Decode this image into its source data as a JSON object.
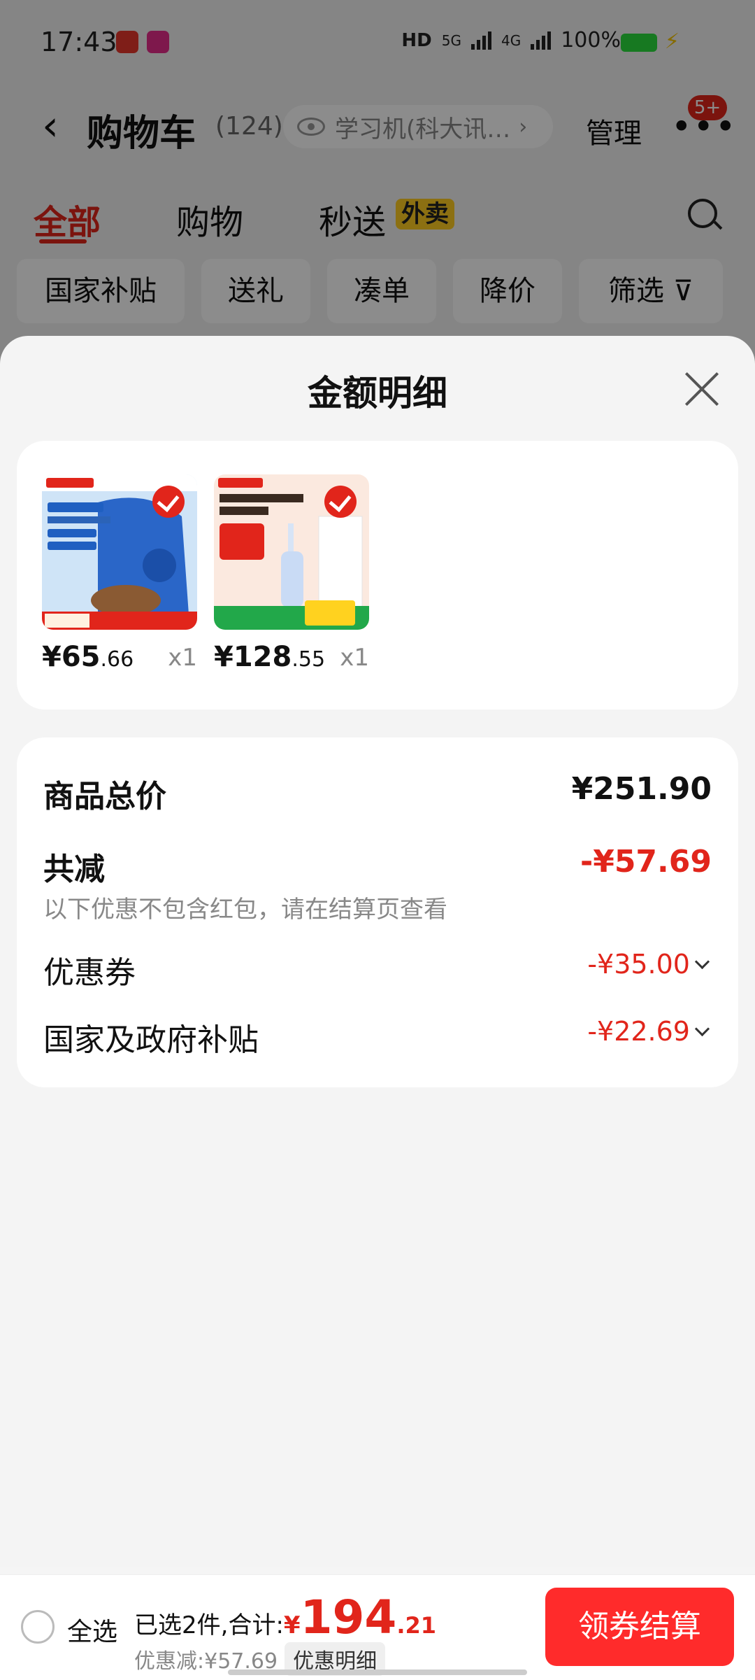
{
  "status_bar": {
    "time": "17:43",
    "hd": "HD",
    "net1": "5G",
    "net2": "4G",
    "battery": "100%"
  },
  "nav": {
    "title": "购物车",
    "count": "(124)",
    "search_text": "学习机(科大讯…",
    "manage": "管理",
    "more": "•••",
    "badge": "5+"
  },
  "tabs": [
    {
      "label": "全部"
    },
    {
      "label": "购物"
    },
    {
      "label": "秒送"
    }
  ],
  "tab_tag": "外卖",
  "filters": [
    {
      "label": "国家补贴"
    },
    {
      "label": "送礼"
    },
    {
      "label": "凑单"
    },
    {
      "label": "降价"
    },
    {
      "label": "筛选"
    }
  ],
  "sheet": {
    "title": "金额明细"
  },
  "products": [
    {
      "price_int": "¥65",
      "price_dec": ".66",
      "qty": "x1"
    },
    {
      "price_int": "¥128",
      "price_dec": ".55",
      "qty": "x1"
    }
  ],
  "summary": {
    "total_label": "商品总价",
    "total_value": "¥251.90",
    "reduce_label": "共减",
    "reduce_value": "-¥57.69",
    "note": "以下优惠不包含红包，请在结算页查看",
    "coupon_label": "优惠券",
    "coupon_value": "-¥35.00",
    "subsidy_label": "国家及政府补贴",
    "subsidy_value": "-¥22.69"
  },
  "bottom": {
    "select_all": "全选",
    "selected_text": "已选2件,合计:",
    "currency": "¥",
    "total_int": "194",
    "total_dec": ".21",
    "discount": "优惠减:¥57.69",
    "detail_button": "优惠明细",
    "checkout": "领券结算"
  },
  "colors": {
    "accent": "#e1251b",
    "checkout": "#ff2b2b"
  }
}
